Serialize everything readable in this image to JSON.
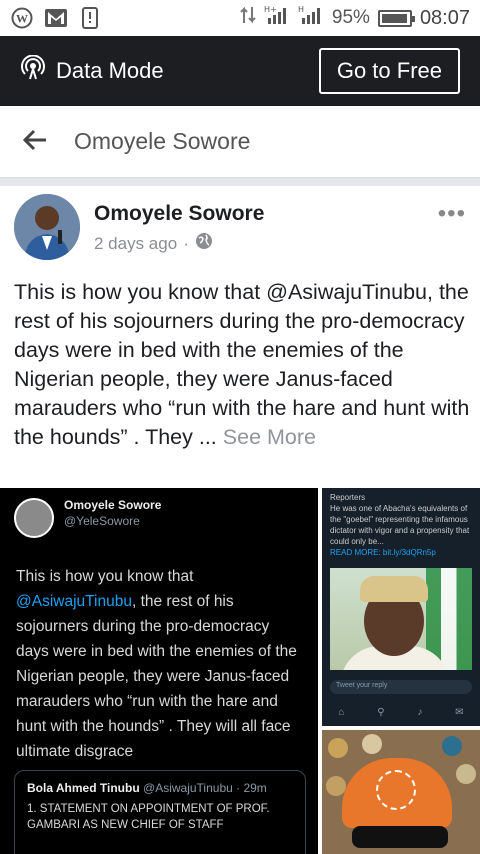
{
  "status_bar": {
    "battery": "95%",
    "battery_level": 0.95,
    "time": "08:07"
  },
  "data_mode": {
    "label": "Data Mode",
    "button": "Go to Free"
  },
  "header": {
    "title": "Omoyele Sowore"
  },
  "post": {
    "author": "Omoyele Sowore",
    "time": "2 days ago",
    "separator": "·",
    "text": "This is how you know that @AsiwajuTinubu, the rest of his sojourners during the pro-democracy days were in bed with the enemies of the Nigerian people, they were Janus-faced marauders who “run with the hare and hunt with the hounds” . They ... ",
    "see_more": "See More"
  },
  "tweet_image": {
    "name": "Omoyele Sowore",
    "handle": "@YeleSowore",
    "text_before": "This is how you know that ",
    "mention": "@AsiwajuTinubu",
    "text_after": ", the rest of his sojourners during the pro-democracy days were in bed with the enemies of the Nigerian people, they were Janus-faced marauders who “run with the hare and hunt with the hounds” . They will all face ultimate disgrace",
    "quote_name": "Bola Ahmed Tinubu",
    "quote_handle": "@AsiwajuTinubu · 29m",
    "quote_text": "1. STATEMENT ON APPOINTMENT OF PROF. GAMBARI AS NEW CHIEF OF STAFF"
  },
  "side_image": {
    "source": "Reporters",
    "text": "He was one of Abacha's equivalents of the \"goebel\" representing the infamous dictator with vigor and a propensity that could only be...",
    "read_more": "READ MORE: bit.ly/3dQRn5p",
    "reply_placeholder": "Tweet your reply"
  }
}
